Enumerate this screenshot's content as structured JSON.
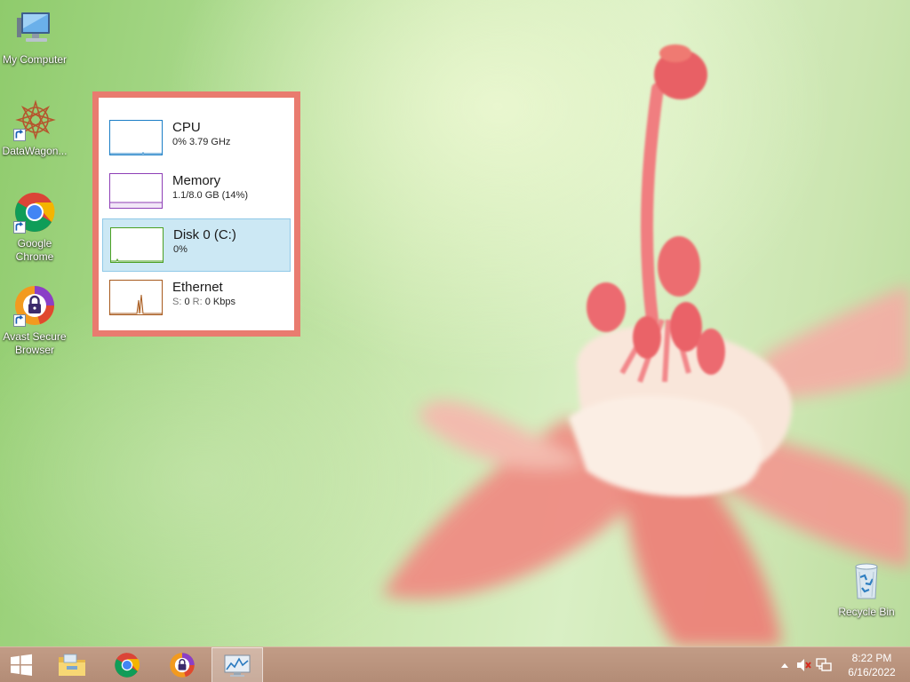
{
  "desktop": {
    "icons": [
      {
        "label": "My Computer",
        "icon": "computer-icon"
      },
      {
        "label": "DataWagon...",
        "icon": "datawagon-icon"
      },
      {
        "label": "Google Chrome",
        "icon": "chrome-icon"
      },
      {
        "label": "Avast Secure Browser",
        "icon": "avast-browser-icon"
      },
      {
        "label": "Recycle Bin",
        "icon": "recycle-bin-icon"
      }
    ]
  },
  "task_manager": {
    "items": [
      {
        "name": "CPU",
        "value": "0% 3.79 GHz",
        "color": "#1b7ec6",
        "selected": false
      },
      {
        "name": "Memory",
        "value": "1.1/8.0 GB (14%)",
        "color": "#8e3fb6",
        "selected": false
      },
      {
        "name": "Disk 0 (C:)",
        "value": "0%",
        "color": "#4aa021",
        "selected": true
      },
      {
        "name": "Ethernet",
        "value_s_label": "S:",
        "value_s": "0",
        "value_r_label": "R:",
        "value_r": "0 Kbps",
        "color": "#a7591c",
        "selected": false
      }
    ]
  },
  "taskbar": {
    "buttons": [
      {
        "icon": "windows-start-icon"
      },
      {
        "icon": "file-explorer-icon"
      },
      {
        "icon": "chrome-icon"
      },
      {
        "icon": "avast-browser-icon"
      },
      {
        "icon": "task-manager-icon",
        "active": true
      }
    ],
    "tray": {
      "icons": [
        "show-hidden-icons-icon",
        "volume-muted-icon",
        "network-icon"
      ],
      "time": "8:22 PM",
      "date": "6/16/2022"
    }
  },
  "colors": {
    "panel_border": "#e97b6f",
    "selection_bg": "#cce8f4",
    "taskbar": "#b8917b"
  }
}
